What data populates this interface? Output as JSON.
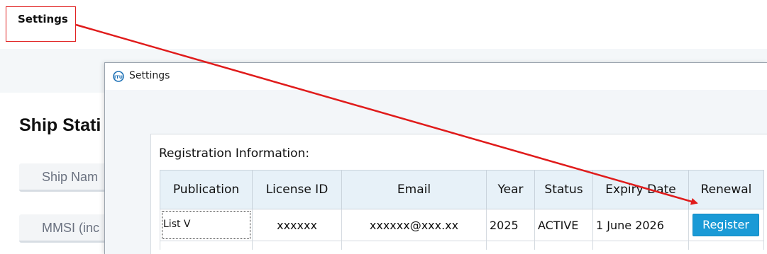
{
  "annotation": {
    "callout_label": "Settings",
    "arrow_color": "#e01b1b"
  },
  "background_page": {
    "title": "Ship Stati",
    "fields": [
      "Ship Nam",
      "MMSI (inc"
    ]
  },
  "dialog": {
    "title": "Settings",
    "app_icon": "itu-logo-icon",
    "section_title": "Registration Information:",
    "table": {
      "headers": [
        "Publication",
        "License ID",
        "Email",
        "Year",
        "Status",
        "Expiry Date",
        "Renewal"
      ],
      "rows": [
        {
          "publication": "List V",
          "license_id": "xxxxxx",
          "email": "xxxxxx@xxx.xx",
          "year": "2025",
          "status": "ACTIVE",
          "expiry_date": "1 June 2026",
          "renewal_button": "Register"
        }
      ]
    },
    "colors": {
      "header_bg": "#e7f1f8",
      "button_bg": "#1a9ad6"
    }
  }
}
